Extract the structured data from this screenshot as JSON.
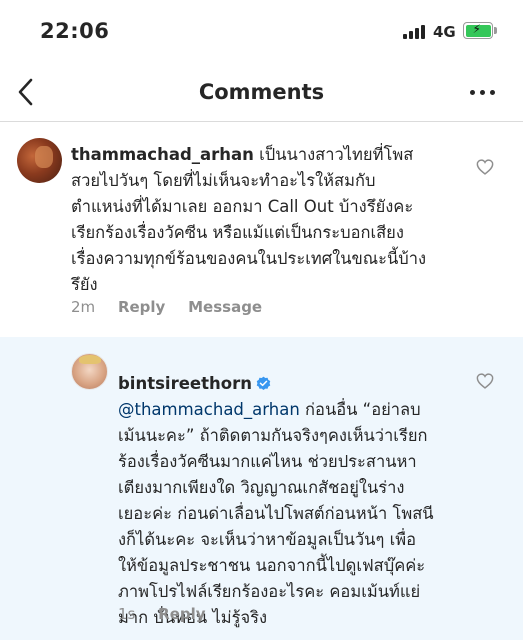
{
  "status_bar": {
    "time": "22:06",
    "network": "4G"
  },
  "nav": {
    "title": "Comments"
  },
  "comments": [
    {
      "username": "thammachad_arhan",
      "lines": [
        " เป็นนางสาวไทยที่โพส",
        "สวยไปวันๆ โดยที่ไม่เห็นจะทำอะไรให้สมกับ",
        "ตำแหน่งที่ได้มาเลย ออกมา Call Out บ้างรึยังคะ",
        "เรียกร้องเรื่องวัคซีน หรือแม้แต่เป็นกระบอกเสียง",
        "เรื่องความทุกข์ร้อนของคนในประเทศในขณะนี้บ้าง",
        "รึยัง"
      ],
      "time": "2m",
      "actions": [
        "Reply",
        "Message"
      ]
    },
    {
      "username": "bintsireethorn",
      "verified": true,
      "mention": "@thammachad_arhan",
      "lines": [
        " ก่อนอื่น “อย่าลบ",
        "เม้นนะคะ” ถ้าติดตามกันจริงๆคงเห็นว่าเรียก",
        "ร้องเรื่องวัคซีนมากแค่ไหน ช่วยประสานหา",
        "เตียงมากเพียงใด วิญญาณเกสัชอยู่ในร่าง",
        "เยอะค่ะ ก่อนด่าเลื่อนไปโพสต์ก่อนหน้า โพสนี",
        "งก็ได้นะคะ จะเห็นว่าหาข้อมูลเป็นวันๆ เพื่อ",
        "ให้ข้อมูลประชาชน นอกจากนี้ไปดูเฟสบุ๊คค่ะ",
        "ภาพโปรไฟล์เรียกร้องอะไรคะ คอมเม้นท์แย่",
        "มาก บั่นทอน ไม่รู้จริง"
      ],
      "time": "1s",
      "actions": [
        "Reply"
      ]
    }
  ],
  "icons": {
    "back": "chevron-left-icon",
    "more": "more-horizontal-icon",
    "like": "heart-outline-icon",
    "verified": "verified-badge-icon",
    "signal": "cellular-signal-icon",
    "battery": "battery-charging-icon"
  },
  "colors": {
    "reply_highlight_bg": "#eff7fd",
    "mention": "#00376b",
    "verified": "#3897f0",
    "battery": "#34c759",
    "meta_text": "#8e8e8e"
  }
}
